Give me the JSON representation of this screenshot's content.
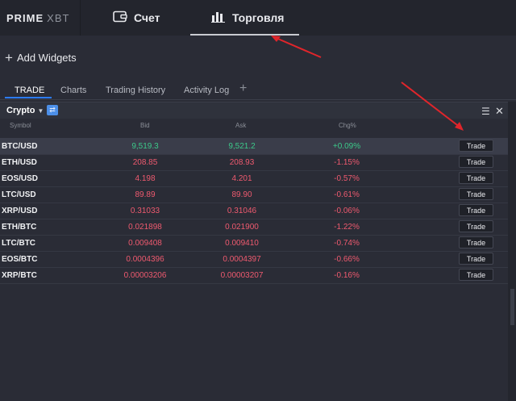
{
  "logo": {
    "bold": "PRIME",
    "light": "XBT"
  },
  "nav": {
    "account": "Счет",
    "trading": "Торговля"
  },
  "add_widgets": "Add Widgets",
  "tabs": [
    "TRADE",
    "Charts",
    "Trading History",
    "Activity Log"
  ],
  "widget": {
    "market_select": "Crypto",
    "columns": {
      "symbol": "Symbol",
      "bid": "Bid",
      "ask": "Ask",
      "chg": "Chg%"
    },
    "trade_label": "Trade",
    "rows": [
      {
        "symbol": "BTC/USD",
        "bid": "9,519.3",
        "ask": "9,521.2",
        "chg": "+0.09%"
      },
      {
        "symbol": "ETH/USD",
        "bid": "208.85",
        "ask": "208.93",
        "chg": "-1.15%"
      },
      {
        "symbol": "EOS/USD",
        "bid": "4.198",
        "ask": "4.201",
        "chg": "-0.57%"
      },
      {
        "symbol": "LTC/USD",
        "bid": "89.89",
        "ask": "89.90",
        "chg": "-0.61%"
      },
      {
        "symbol": "XRP/USD",
        "bid": "0.31033",
        "ask": "0.31046",
        "chg": "-0.06%"
      },
      {
        "symbol": "ETH/BTC",
        "bid": "0.021898",
        "ask": "0.021900",
        "chg": "-1.22%"
      },
      {
        "symbol": "LTC/BTC",
        "bid": "0.009408",
        "ask": "0.009410",
        "chg": "-0.74%"
      },
      {
        "symbol": "EOS/BTC",
        "bid": "0.0004396",
        "ask": "0.0004397",
        "chg": "-0.66%"
      },
      {
        "symbol": "XRP/BTC",
        "bid": "0.00003206",
        "ask": "0.00003207",
        "chg": "-0.16%"
      }
    ]
  },
  "colors": {
    "up": "#3cc98a",
    "down": "#ef5a6f",
    "accent": "#2c7cff",
    "annotation": "#e0252b"
  },
  "icons": [
    "wallet-icon",
    "bar-chart-icon",
    "plus-icon",
    "caret-down-icon",
    "list-menu-icon",
    "close-icon"
  ]
}
